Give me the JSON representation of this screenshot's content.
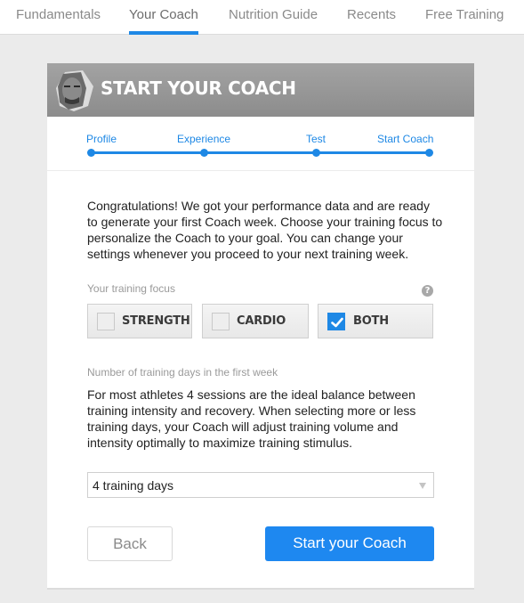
{
  "nav": {
    "tabs": [
      {
        "label": "Fundamentals",
        "active": false
      },
      {
        "label": "Your Coach",
        "active": true
      },
      {
        "label": "Nutrition Guide",
        "active": false
      },
      {
        "label": "Recents",
        "active": false
      },
      {
        "label": "Free Training",
        "active": false
      }
    ]
  },
  "card": {
    "title": "START YOUR COACH",
    "avatar_icon": "coach-avatar",
    "steps": [
      {
        "label": "Profile"
      },
      {
        "label": "Experience"
      },
      {
        "label": "Test"
      },
      {
        "label": "Start Coach"
      }
    ],
    "intro": "Congratulations! We got your performance data and are ready to generate your first Coach week. Choose your training focus to personalize the Coach to your goal. You can change your settings whenever you proceed to your next training week.",
    "focus": {
      "label": "Your training focus",
      "help_icon": "question-mark-icon",
      "help_glyph": "?",
      "options": [
        {
          "label": "STRENGTH",
          "checked": false
        },
        {
          "label": "CARDIO",
          "checked": false
        },
        {
          "label": "BOTH",
          "checked": true
        }
      ]
    },
    "days": {
      "label": "Number of training days in the first week",
      "description": "For most athletes 4 sessions are the ideal balance between training intensity and recovery. When selecting more or less training days, your Coach will adjust training volume and intensity optimally to maximize training stimulus.",
      "selected": "4 training days"
    },
    "buttons": {
      "back": "Back",
      "start": "Start your Coach"
    }
  },
  "colors": {
    "accent": "#1e88e5",
    "header_bg": "#999999",
    "page_bg": "#ebebeb"
  }
}
